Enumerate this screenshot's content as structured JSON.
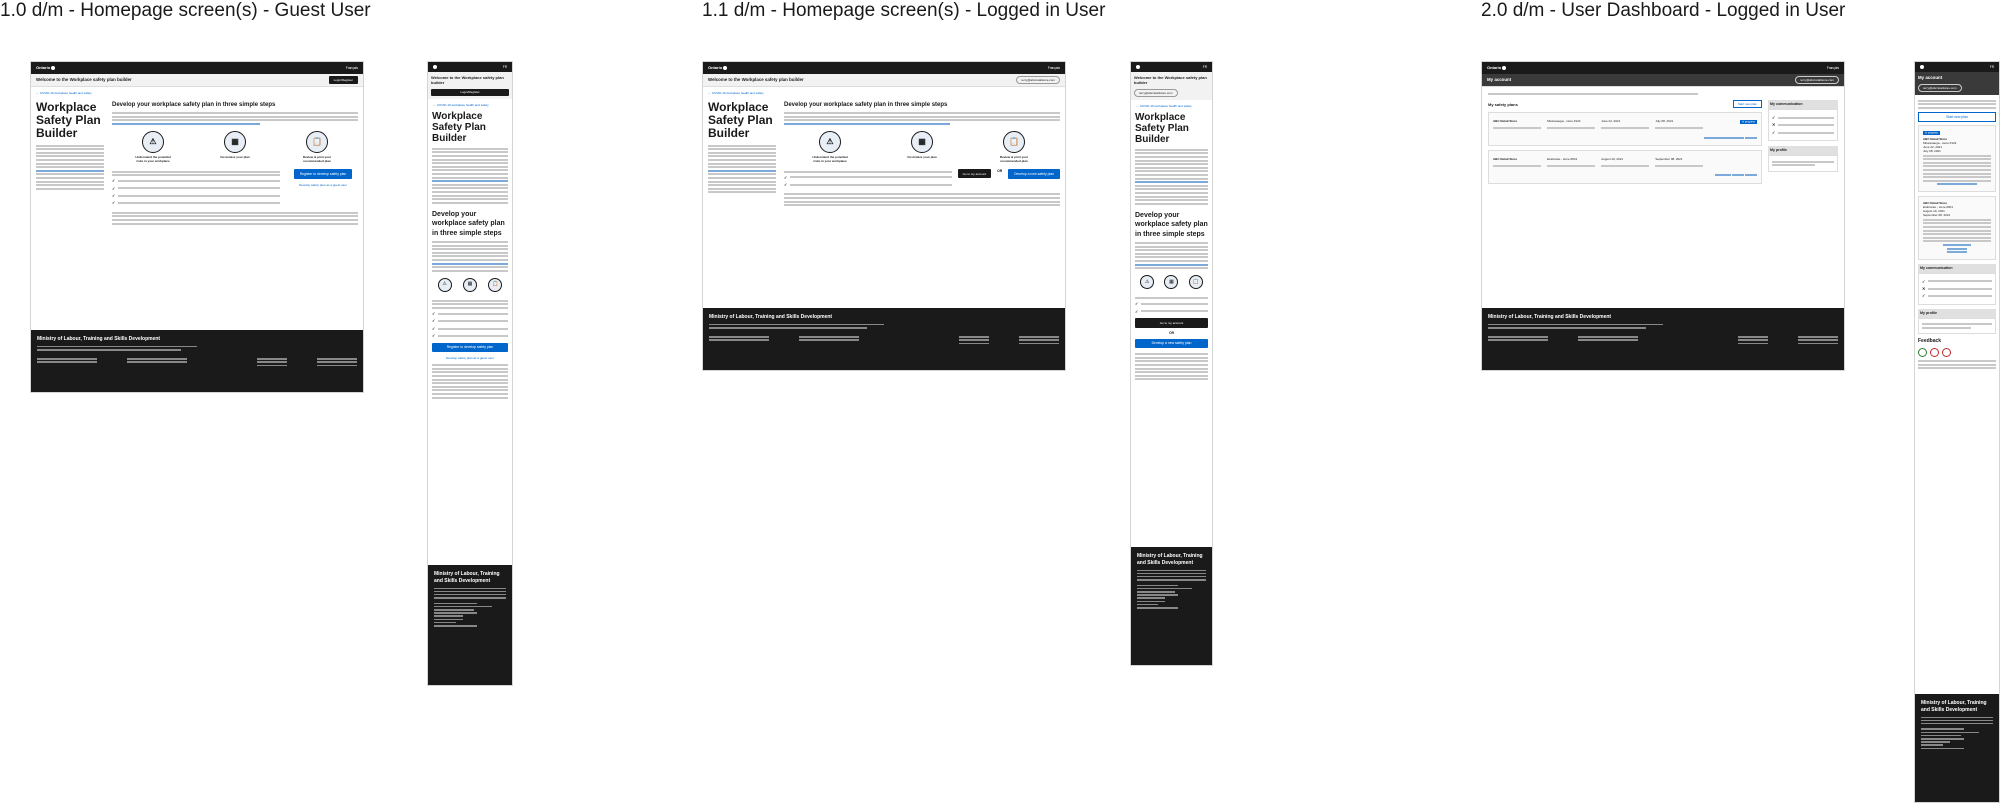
{
  "sections": [
    {
      "title": "1.0 d/m - Homepage screen(s) - Guest User"
    },
    {
      "title": "1.1 d/m - Homepage screen(s) - Logged in User"
    },
    {
      "title": "2.0 d/m - User Dashboard - Logged in User"
    }
  ],
  "common": {
    "ontario": "Ontario",
    "francais": "Français",
    "welcome": "Welcome to the Workplace safety plan builder",
    "breadcrumb": "COVID-19 workplace health and safety",
    "page_title": "Workplace Safety Plan Builder",
    "heading": "Develop your workplace safety plan in three simple steps",
    "steps": [
      "Understand the potential risks in your workplace",
      "Customize your plan",
      "Review & print your recommended plan"
    ],
    "footer_title": "Ministry of Labour, Training and Skills Development"
  },
  "guest": {
    "login_button": "Login/Register",
    "register_button": "Register to develop safety plan",
    "guest_link": "Develop safety plan as a guest user"
  },
  "logged": {
    "email": "terry@abcretailstore.com",
    "go_account": "Go to my account",
    "or": "OR",
    "new_plan": "Develop a new safety plan"
  },
  "dashboard": {
    "title": "My account",
    "my_plans": "My safety plans",
    "start_plan": "Start new plan",
    "my_comm": "My communication",
    "my_profile": "My profile",
    "feedback": "Feedback",
    "plans": [
      {
        "name": "ABC Retail Store",
        "store": "Mississauga - store #123",
        "created": "June 22, 2021",
        "updated": "July 08, 2021",
        "status": "In progress"
      },
      {
        "name": "ABC Retail Store",
        "store": "Etobicoke - store #001",
        "created": "August 19, 2021",
        "updated": "September 08, 2021",
        "status": ""
      }
    ]
  }
}
